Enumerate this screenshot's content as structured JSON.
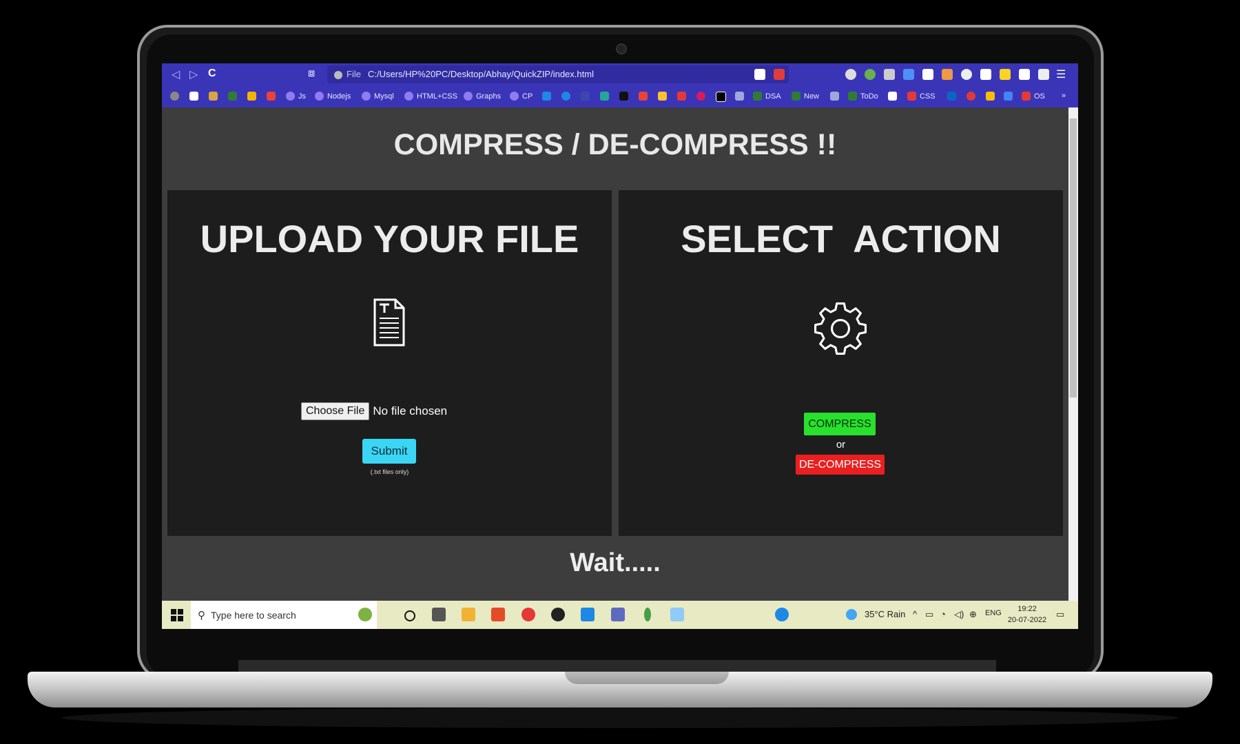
{
  "browser": {
    "nav": {
      "back": "◁",
      "forward": "▷",
      "reload": "C",
      "bookmark": "⧈"
    },
    "address": {
      "scheme": "File",
      "url": "C:/Users/HP%20PC/Desktop/Abhay/QuickZIP/index.html"
    },
    "bookmarks": [
      "Js",
      "Nodejs",
      "Mysql",
      "HTML+CSS",
      "Graphs",
      "CP",
      "DSA",
      "New",
      "ToDo",
      "CSS",
      "OS"
    ],
    "more": "»"
  },
  "page": {
    "title": "COMPRESS / DE-COMPRESS !!",
    "upload": {
      "heading": "UPLOAD YOUR FILE",
      "choose_label": "Choose File",
      "no_file": "No file chosen",
      "submit": "Submit",
      "hint": "(.txt files only)"
    },
    "action": {
      "heading": "SELECT  ACTION",
      "compress": "COMPRESS",
      "or": "or",
      "decompress": "DE-COMPRESS"
    },
    "status": "Wait....."
  },
  "taskbar": {
    "search_placeholder": "Type here to search",
    "weather": "35°C  Rain",
    "language": "ENG",
    "time": "19:22",
    "date": "20-07-2022"
  },
  "colors": {
    "browser_chrome": "#3a35b7",
    "compress": "#27e12c",
    "decompress": "#ea1f1f",
    "submit": "#3ad6f3"
  }
}
